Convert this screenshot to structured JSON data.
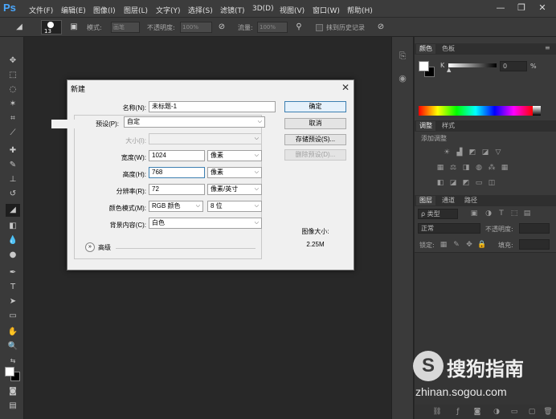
{
  "app": {
    "logo": "Ps"
  },
  "menu": [
    "文件(F)",
    "编辑(E)",
    "图像(I)",
    "图层(L)",
    "文字(Y)",
    "选择(S)",
    "滤镜(T)",
    "3D(D)",
    "视图(V)",
    "窗口(W)",
    "帮助(H)"
  ],
  "window_controls": {
    "minimize": "—",
    "restore": "❐",
    "close": "✕"
  },
  "options_bar": {
    "brush_size": "13",
    "mode_label": "模式:",
    "mode_value": "画笔",
    "opacity_label": "不透明度:",
    "opacity_value": "100%",
    "flow_label": "流量:",
    "flow_value": "100%",
    "history_label": "抹到历史记录"
  },
  "dialog": {
    "title": "新建",
    "name_label": "名称(N):",
    "name_value": "未标题-1",
    "preset_label": "预设(P):",
    "preset_value": "自定",
    "size_label": "大小(I):",
    "size_value": "",
    "width_label": "宽度(W):",
    "width_value": "1024",
    "width_unit": "像素",
    "height_label": "高度(H):",
    "height_value": "768",
    "height_unit": "像素",
    "resolution_label": "分辨率(R):",
    "resolution_value": "72",
    "resolution_unit": "像素/英寸",
    "color_mode_label": "颜色模式(M):",
    "color_mode_value": "RGB 颜色",
    "bit_depth_value": "8 位",
    "background_label": "背景内容(C):",
    "background_value": "白色",
    "advanced_label": "高级",
    "ok_label": "确定",
    "cancel_label": "取消",
    "save_preset_label": "存储预设(S)...",
    "delete_preset_label": "删除预设(D)...",
    "image_size_label": "图像大小:",
    "image_size_value": "2.25M"
  },
  "color_panel": {
    "tabs": [
      "颜色",
      "色板"
    ],
    "channel_label": "K",
    "channel_value": "0",
    "channel_unit": "%"
  },
  "adjust_panel": {
    "tabs": [
      "调整",
      "样式"
    ],
    "add_label": "添加调整"
  },
  "layers_panel": {
    "tabs": [
      "图层",
      "通道",
      "路径"
    ],
    "filter_label": "ρ 类型",
    "blend_mode": "正常",
    "opacity_label": "不透明度:",
    "lock_label": "锁定:",
    "fill_label": "填充:"
  },
  "watermark": {
    "logo": "S",
    "text": "搜狗指南",
    "url": "zhinan.sogou.com"
  }
}
